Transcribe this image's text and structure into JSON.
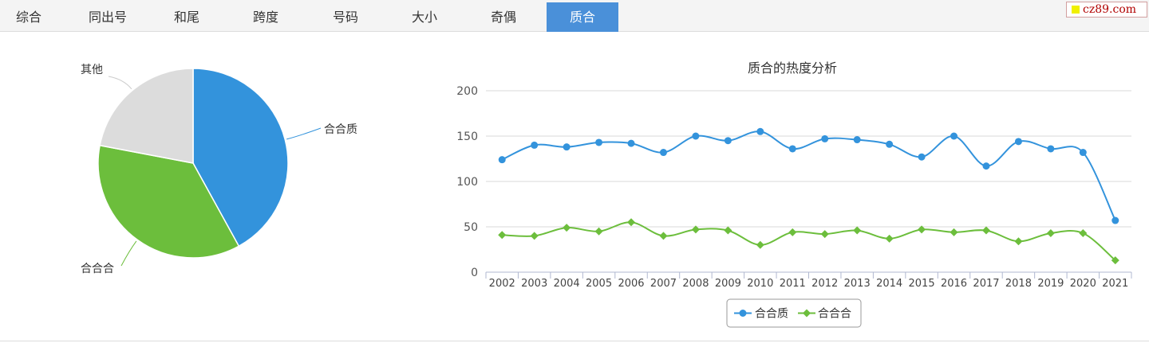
{
  "tabs": [
    {
      "label": "综合"
    },
    {
      "label": "同出号"
    },
    {
      "label": "和尾"
    },
    {
      "label": "跨度"
    },
    {
      "label": "号码"
    },
    {
      "label": "大小"
    },
    {
      "label": "奇偶"
    },
    {
      "label": "质合",
      "active": true
    }
  ],
  "logo": {
    "text": "cz89.com"
  },
  "chart_data": [
    {
      "type": "pie",
      "title": "",
      "labels": [
        "合合质",
        "合合合",
        "其他"
      ],
      "values": [
        42,
        36,
        22
      ],
      "colors": [
        "#3393dc",
        "#6cbe3c",
        "#dcdcdc"
      ]
    },
    {
      "type": "line",
      "title": "质合的热度分析",
      "categories": [
        "2002",
        "2003",
        "2004",
        "2005",
        "2006",
        "2007",
        "2008",
        "2009",
        "2010",
        "2011",
        "2012",
        "2013",
        "2014",
        "2015",
        "2016",
        "2017",
        "2018",
        "2019",
        "2020",
        "2021"
      ],
      "ylim": [
        0,
        200
      ],
      "yticks": [
        0,
        50,
        100,
        150,
        200
      ],
      "grid": true,
      "legend": "bottom-center",
      "series": [
        {
          "name": "合合质",
          "color": "#3393dc",
          "marker": "circle",
          "values": [
            124,
            140,
            138,
            143,
            142,
            132,
            150,
            145,
            155,
            136,
            147,
            146,
            141,
            127,
            150,
            117,
            144,
            136,
            132,
            57
          ]
        },
        {
          "name": "合合合",
          "color": "#6cbe3c",
          "marker": "diamond",
          "values": [
            41,
            40,
            49,
            45,
            55,
            40,
            47,
            46,
            30,
            44,
            42,
            46,
            37,
            47,
            44,
            46,
            34,
            43,
            43,
            13
          ]
        }
      ]
    }
  ]
}
